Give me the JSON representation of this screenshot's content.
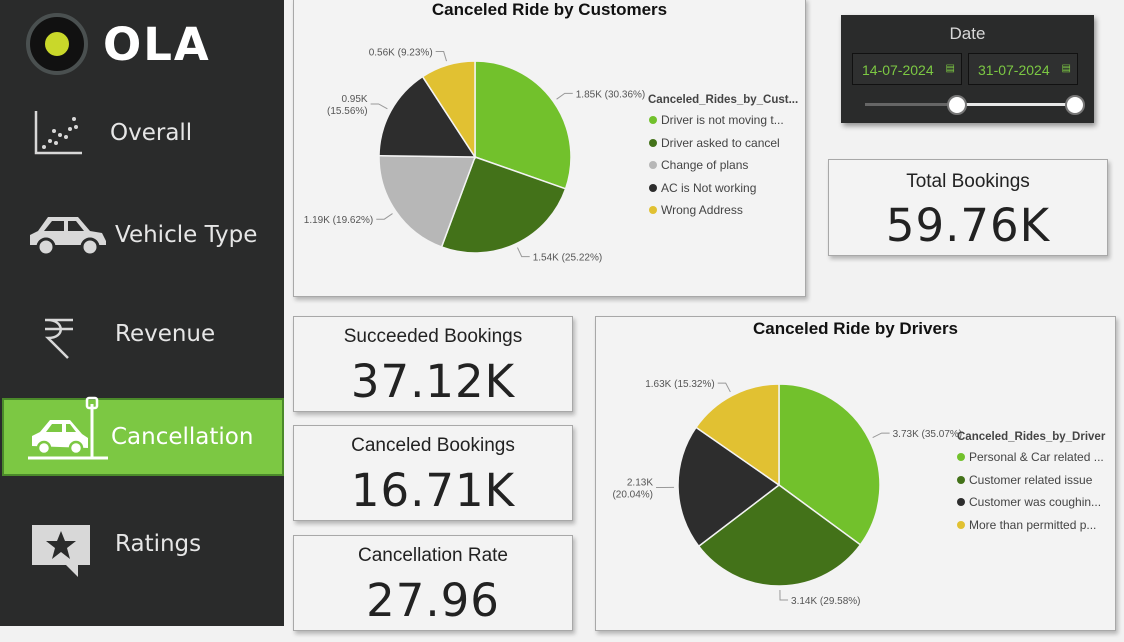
{
  "brand": {
    "name": "OLA"
  },
  "sidebar": {
    "items": [
      {
        "label": "Overall",
        "icon": "scatter-chart-icon"
      },
      {
        "label": "Vehicle Type",
        "icon": "car-icon"
      },
      {
        "label": "Revenue",
        "icon": "rupee-icon"
      },
      {
        "label": "Cancellation",
        "icon": "car-crash-icon",
        "active": true
      },
      {
        "label": "Ratings",
        "icon": "star-chat-icon"
      }
    ]
  },
  "date_filter": {
    "title": "Date",
    "start": "14-07-2024",
    "end": "31-07-2024",
    "start_fraction": 0.44,
    "end_fraction": 1.0
  },
  "kpis": {
    "total_bookings": {
      "title": "Total Bookings",
      "value": "59.76K"
    },
    "succeeded_bookings": {
      "title": "Succeeded Bookings",
      "value": "37.12K"
    },
    "canceled_bookings": {
      "title": "Canceled Bookings",
      "value": "16.71K"
    },
    "cancellation_rate": {
      "title": "Cancellation Rate",
      "value": "27.96"
    }
  },
  "colors": {
    "accent": "#7cc843",
    "sidebar": "#2a2b2b",
    "active_nav": "#7cc843"
  },
  "chart_data": [
    {
      "type": "pie",
      "title": "Canceled Ride by Customers",
      "legend_title": "Canceled_Rides_by_Cust...",
      "legend_position": "right",
      "labels": [
        "Driver is not moving t...",
        "Driver asked to cancel",
        "Change of plans",
        "AC is Not working",
        "Wrong Address"
      ],
      "values": [
        1.85,
        1.54,
        1.19,
        0.95,
        0.56
      ],
      "data_labels": [
        "1.85K (30.36%)",
        "1.54K (25.22%)",
        "1.19K (19.62%)",
        "0.95K (15.56%)",
        "0.56K (9.23%)"
      ],
      "percents": [
        30.36,
        25.22,
        19.62,
        15.56,
        9.23
      ],
      "colors": [
        "#72c12c",
        "#437219",
        "#b7b7b7",
        "#2d2d2d",
        "#e1c132"
      ]
    },
    {
      "type": "pie",
      "title": "Canceled Ride by Drivers",
      "legend_title": "Canceled_Rides_by_Driver",
      "legend_position": "right",
      "labels": [
        "Personal & Car related ...",
        "Customer related issue",
        "Customer was coughin...",
        "More than permitted p..."
      ],
      "values": [
        3.73,
        3.14,
        2.13,
        1.63
      ],
      "data_labels": [
        "3.73K (35.07%)",
        "3.14K (29.58%)",
        "2.13K (20.04%)",
        "1.63K (15.32%)"
      ],
      "percents": [
        35.07,
        29.58,
        20.04,
        15.32
      ],
      "colors": [
        "#72c12c",
        "#437219",
        "#2d2d2d",
        "#e1c132"
      ]
    }
  ]
}
